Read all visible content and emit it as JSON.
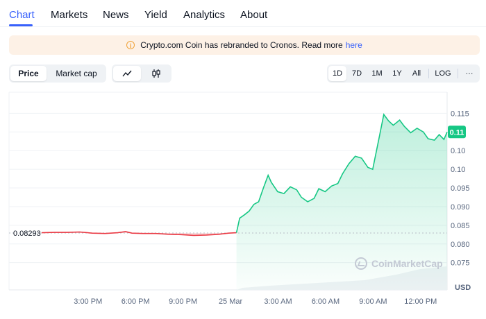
{
  "nav": {
    "items": [
      {
        "label": "Chart",
        "active": true
      },
      {
        "label": "Markets"
      },
      {
        "label": "News"
      },
      {
        "label": "Yield"
      },
      {
        "label": "Analytics"
      },
      {
        "label": "About"
      }
    ]
  },
  "banner": {
    "icon": "info-icon",
    "text": "Crypto.com Coin has rebranded to Cronos. Read more",
    "link": "here"
  },
  "toolbar": {
    "metric_tabs": [
      {
        "label": "Price",
        "active": true
      },
      {
        "label": "Market cap"
      }
    ],
    "chart_types": [
      {
        "icon": "line-chart-icon",
        "active": true
      },
      {
        "icon": "candlestick-icon"
      }
    ],
    "ranges": [
      {
        "label": "1D",
        "active": true
      },
      {
        "label": "7D"
      },
      {
        "label": "1M"
      },
      {
        "label": "1Y"
      },
      {
        "label": "All"
      }
    ],
    "log_label": "LOG",
    "more_label": "···"
  },
  "watermark": "CoinMarketCap",
  "colors": {
    "up": "#16c784",
    "down": "#ea3943",
    "accent": "#3861fb"
  },
  "chart_data": {
    "type": "area",
    "open_label": "0.08293",
    "current_label": "0.11",
    "y_ticks": [
      "0.115",
      "0.11",
      "0.10",
      "0.10",
      "0.095",
      "0.090",
      "0.085",
      "0.080",
      "0.075"
    ],
    "y_unit": "USD",
    "x_ticks": [
      "3:00 PM",
      "6:00 PM",
      "9:00 PM",
      "25 Mar",
      "3:00 AM",
      "6:00 AM",
      "9:00 AM",
      "12:00 PM"
    ],
    "ylim": [
      0.072,
      0.118
    ],
    "baseline": 0.08293,
    "x_range_hours": [
      12.6,
      36.3
    ],
    "series": [
      {
        "values": [
          [
            12.6,
            0.083
          ],
          [
            13.4,
            0.0831
          ],
          [
            14.2,
            0.0831
          ],
          [
            15.0,
            0.0832
          ],
          [
            15.8,
            0.0829
          ],
          [
            16.6,
            0.0828
          ],
          [
            17.4,
            0.083
          ],
          [
            17.9,
            0.0833
          ],
          [
            18.3,
            0.0829
          ],
          [
            19.0,
            0.0828
          ],
          [
            19.8,
            0.0828
          ],
          [
            20.6,
            0.0826
          ],
          [
            21.4,
            0.0825
          ],
          [
            22.2,
            0.0823
          ],
          [
            23.0,
            0.0824
          ],
          [
            23.8,
            0.0826
          ],
          [
            24.4,
            0.0829
          ],
          [
            24.9,
            0.083
          ],
          [
            25.1,
            0.0869
          ],
          [
            25.4,
            0.0878
          ],
          [
            25.7,
            0.0888
          ],
          [
            26.0,
            0.0906
          ],
          [
            26.3,
            0.0913
          ],
          [
            26.6,
            0.095
          ],
          [
            26.9,
            0.0984
          ],
          [
            27.1,
            0.0965
          ],
          [
            27.5,
            0.094
          ],
          [
            27.9,
            0.0935
          ],
          [
            28.3,
            0.0953
          ],
          [
            28.7,
            0.0945
          ],
          [
            29.0,
            0.0925
          ],
          [
            29.4,
            0.0913
          ],
          [
            29.8,
            0.0922
          ],
          [
            30.1,
            0.0948
          ],
          [
            30.5,
            0.094
          ],
          [
            30.9,
            0.0955
          ],
          [
            31.3,
            0.0962
          ],
          [
            31.6,
            0.0988
          ],
          [
            32.0,
            0.1015
          ],
          [
            32.4,
            0.1035
          ],
          [
            32.8,
            0.103
          ],
          [
            33.2,
            0.1005
          ],
          [
            33.5,
            0.1
          ],
          [
            33.9,
            0.1083
          ],
          [
            34.2,
            0.1147
          ],
          [
            34.5,
            0.113
          ],
          [
            34.8,
            0.1118
          ],
          [
            35.2,
            0.1132
          ],
          [
            35.5,
            0.1115
          ],
          [
            35.9,
            0.1098
          ],
          [
            36.3,
            0.111
          ],
          [
            36.7,
            0.11
          ],
          [
            37.0,
            0.1082
          ],
          [
            37.4,
            0.1078
          ],
          [
            37.7,
            0.1093
          ],
          [
            38.0,
            0.108
          ],
          [
            38.2,
            0.11
          ]
        ]
      }
    ]
  }
}
